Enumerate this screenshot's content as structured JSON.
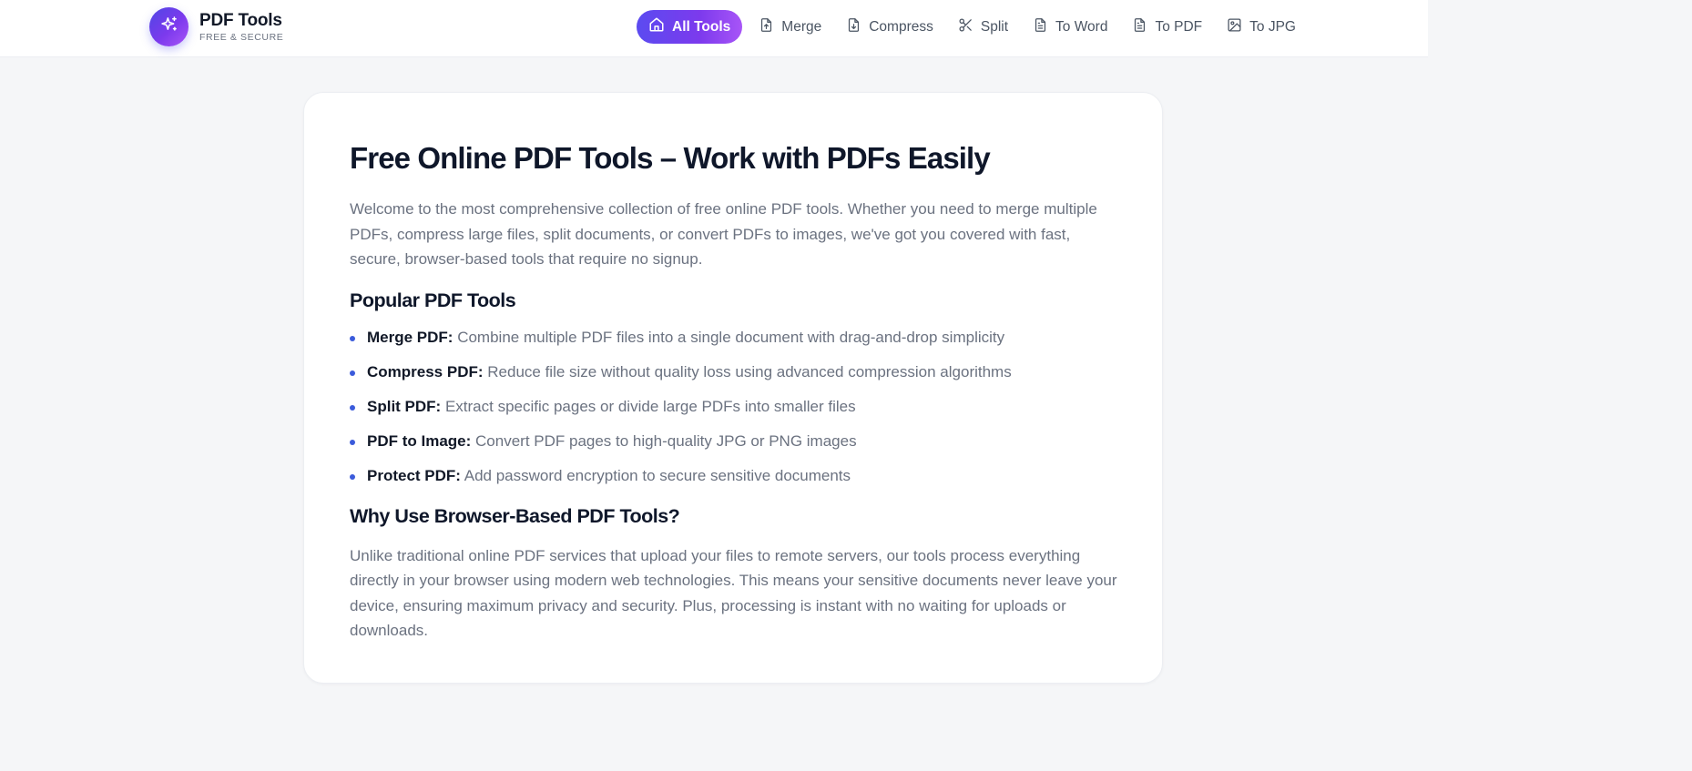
{
  "brand": {
    "name": "PDF Tools",
    "tagline": "FREE & SECURE",
    "logo_icon": "sparkles-icon",
    "gradient": [
      "#4f46e5",
      "#a855f7"
    ]
  },
  "nav": {
    "items": [
      {
        "label": "All Tools",
        "icon": "home-icon",
        "active": true
      },
      {
        "label": "Merge",
        "icon": "file-plus-icon"
      },
      {
        "label": "Compress",
        "icon": "file-download-icon"
      },
      {
        "label": "Split",
        "icon": "scissors-icon"
      },
      {
        "label": "To Word",
        "icon": "file-text-icon"
      },
      {
        "label": "To PDF",
        "icon": "file-text-icon"
      },
      {
        "label": "To JPG",
        "icon": "image-icon"
      }
    ]
  },
  "article": {
    "title": "Free Online PDF Tools – Work with PDFs Easily",
    "intro": "Welcome to the most comprehensive collection of free online PDF tools. Whether you need to merge multiple PDFs, compress large files, split documents, or convert PDFs to images, we've got you covered with fast, secure, browser-based tools that require no signup.",
    "popular_heading": "Popular PDF Tools",
    "tools": [
      {
        "name": "Merge PDF:",
        "desc": " Combine multiple PDF files into a single document with drag-and-drop simplicity"
      },
      {
        "name": "Compress PDF:",
        "desc": " Reduce file size without quality loss using advanced compression algorithms"
      },
      {
        "name": "Split PDF:",
        "desc": " Extract specific pages or divide large PDFs into smaller files"
      },
      {
        "name": "PDF to Image:",
        "desc": " Convert PDF pages to high-quality JPG or PNG images"
      },
      {
        "name": "Protect PDF:",
        "desc": " Add password encryption to secure sensitive documents"
      }
    ],
    "why_heading": "Why Use Browser-Based PDF Tools?",
    "why_text": "Unlike traditional online PDF services that upload your files to remote servers, our tools process everything directly in your browser using modern web technologies. This means your sensitive documents never leave your device, ensuring maximum privacy and security. Plus, processing is instant with no waiting for uploads or downloads."
  },
  "colors": {
    "accent": "#7c3aed",
    "bullet": "#3b5bdb",
    "heading": "#0f172a",
    "body_text": "#6b7280",
    "page_bg": "#f5f6f8"
  }
}
